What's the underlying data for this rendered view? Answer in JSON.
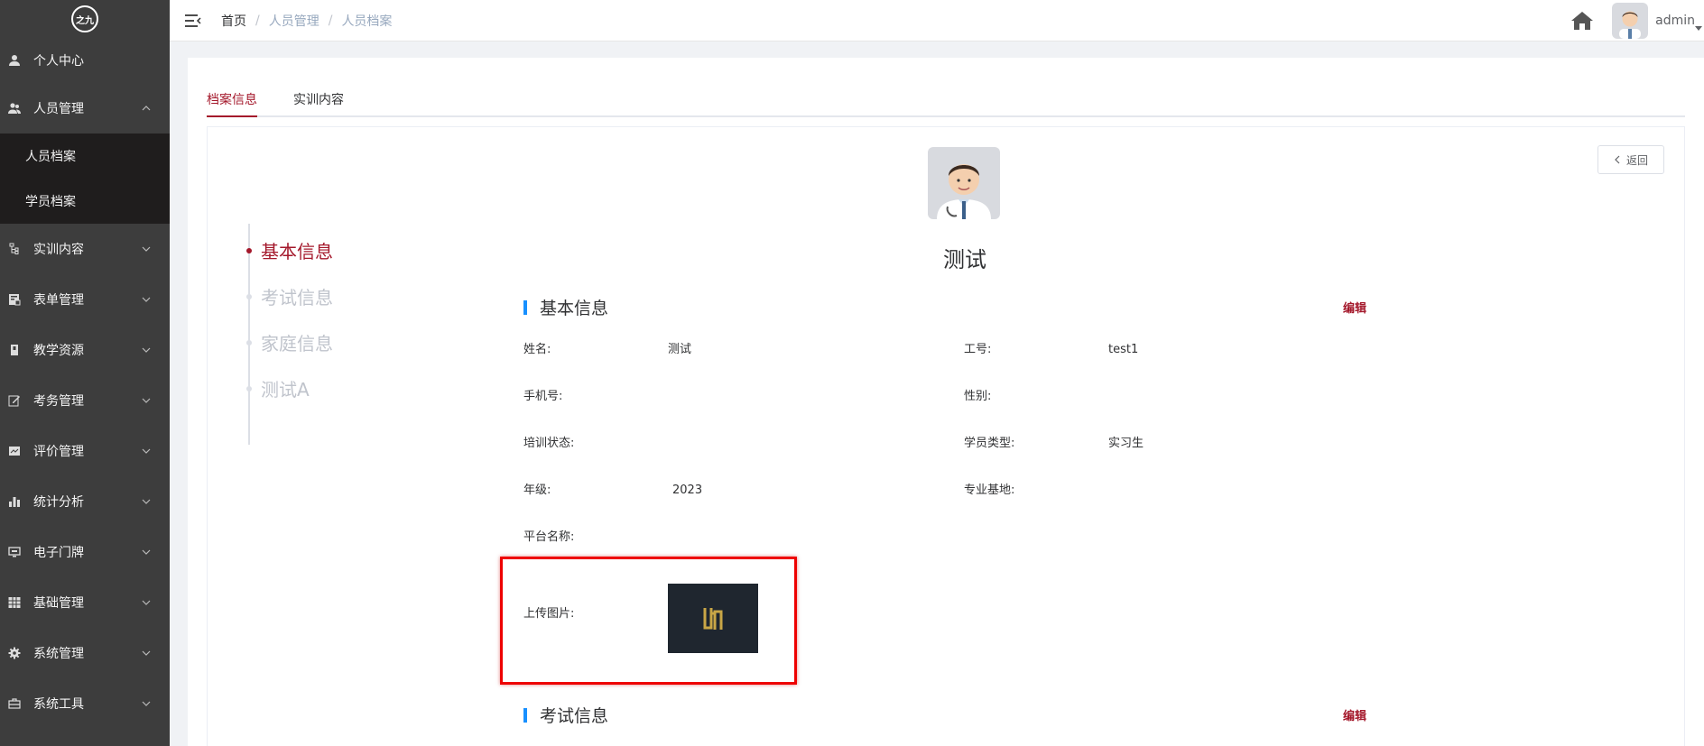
{
  "logo": {
    "text": "之九"
  },
  "sidebar": {
    "items": [
      {
        "label": "个人中心",
        "icon": "user-icon",
        "expanded": false
      },
      {
        "label": "人员管理",
        "icon": "users-icon",
        "expanded": true,
        "children": [
          {
            "label": "人员档案"
          },
          {
            "label": "学员档案"
          }
        ]
      },
      {
        "label": "实训内容",
        "icon": "tree-icon",
        "expanded": false
      },
      {
        "label": "表单管理",
        "icon": "form-icon",
        "expanded": false
      },
      {
        "label": "教学资源",
        "icon": "book-icon",
        "expanded": false
      },
      {
        "label": "考务管理",
        "icon": "edit-icon",
        "expanded": false
      },
      {
        "label": "评价管理",
        "icon": "chart-card-icon",
        "expanded": false
      },
      {
        "label": "统计分析",
        "icon": "bar-chart-icon",
        "expanded": false
      },
      {
        "label": "电子门牌",
        "icon": "monitor-icon",
        "expanded": false
      },
      {
        "label": "基础管理",
        "icon": "grid-icon",
        "expanded": false
      },
      {
        "label": "系统管理",
        "icon": "gear-icon",
        "expanded": false
      },
      {
        "label": "系统工具",
        "icon": "toolbox-icon",
        "expanded": false
      }
    ]
  },
  "header": {
    "breadcrumb": [
      "首页",
      "人员管理",
      "人员档案"
    ],
    "user": "admin"
  },
  "tabs": [
    {
      "label": "档案信息",
      "active": true
    },
    {
      "label": "实训内容",
      "active": false
    }
  ],
  "back_label": "返回",
  "anchors": [
    {
      "label": "基本信息",
      "active": true
    },
    {
      "label": "考试信息",
      "active": false
    },
    {
      "label": "家庭信息",
      "active": false
    },
    {
      "label": "测试A",
      "active": false
    }
  ],
  "profile": {
    "name": "测试"
  },
  "basic_section": {
    "title": "基本信息",
    "edit": "编辑",
    "fields": {
      "name": {
        "label": "姓名:",
        "value": "测试"
      },
      "job_no": {
        "label": "工号:",
        "value": "test1"
      },
      "phone": {
        "label": "手机号:",
        "value": ""
      },
      "gender": {
        "label": "性别:",
        "value": ""
      },
      "train_status": {
        "label": "培训状态:",
        "value": ""
      },
      "student_type": {
        "label": "学员类型:",
        "value": "实习生"
      },
      "grade": {
        "label": "年级:",
        "value": "2023"
      },
      "base": {
        "label": "专业基地:",
        "value": ""
      },
      "platform": {
        "label": "平台名称:",
        "value": ""
      },
      "upload": {
        "label": "上传图片:"
      }
    }
  },
  "exam_section": {
    "title": "考试信息",
    "edit": "编辑"
  },
  "colors": {
    "accent": "#a4182b",
    "sidebar_bg": "#3d3d3d",
    "submenu_bg": "#1f1d1d",
    "section_bar": "#1890ff",
    "highlight": "#e00000"
  }
}
